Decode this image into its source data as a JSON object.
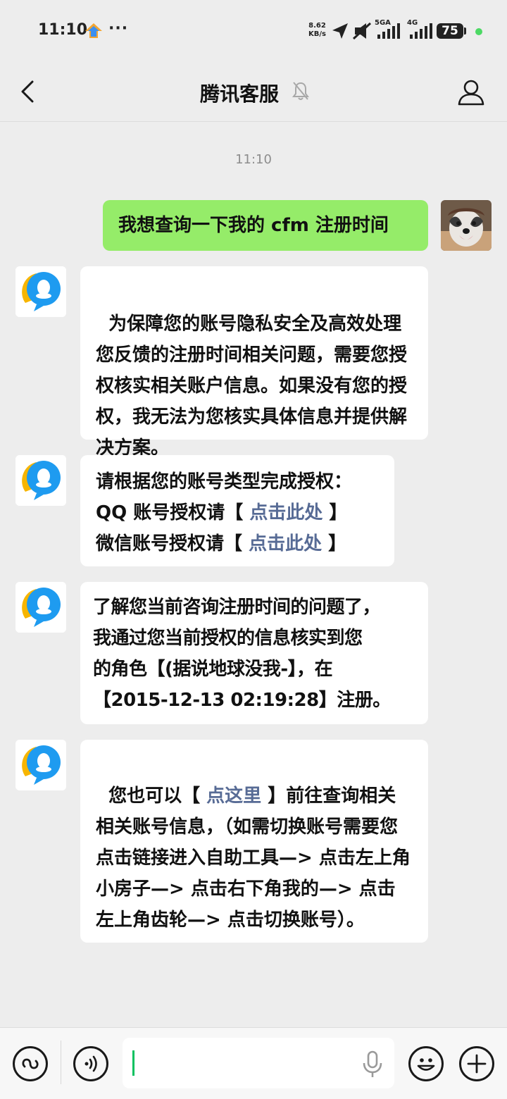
{
  "status_bar": {
    "time": "11:10",
    "dots": "···",
    "net_speed_value": "8.62",
    "net_speed_unit": "KB/s",
    "signal_label_1": "5GA",
    "signal_label_2": "4G",
    "battery": "75",
    "battery_level": 0.75,
    "icons": [
      "app-notification-icon",
      "location-arrow-icon",
      "mute-icon",
      "signal-5ga-icon",
      "signal-4g-icon",
      "battery-icon"
    ]
  },
  "header": {
    "title": "腾讯客服",
    "icons": [
      "back-chevron-icon",
      "bell-muted-icon",
      "profile-icon"
    ]
  },
  "chat": {
    "timestamp": "11:10",
    "messages": [
      {
        "sender": "me",
        "text": "我想查询一下我的 cfm 注册时间"
      },
      {
        "sender": "bot",
        "text": "为保障您的账号隐私安全及高效处理您反馈的注册时间相关问题，需要您授权核实相关账户信息。如果没有您的授权，我无法为您核实具体信息并提供解决方案。"
      },
      {
        "sender": "bot",
        "line1": "请根据您的账号类型完成授权：",
        "line2_prefix": "QQ 账号授权请【 ",
        "line2_link": "点击此处",
        "line2_suffix": " 】",
        "line3_prefix": "微信账号授权请【 ",
        "line3_link": "点击此处",
        "line3_suffix": " 】"
      },
      {
        "sender": "bot",
        "line1": "了解您当前咨询注册时间的问题了，",
        "line2": "我通过您当前授权的信息核实到您",
        "line3": "的角色【(据说地球没我-】，在",
        "line4": "【2015-12-13 02:19:28】注册。"
      },
      {
        "sender": "bot",
        "prefix": "您也可以【 ",
        "link": "点这里",
        "suffix": " 】前往查询相关相关账号信息，（如需切换账号需要您点击链接进入自助工具—> 点击左上角小房子—> 点击右下角我的—> 点击左上角齿轮—> 点击切换账号）。"
      }
    ]
  },
  "input_bar": {
    "value": "",
    "icons": [
      "mini-program-icon",
      "voice-icon",
      "mic-icon",
      "emoji-icon",
      "plus-icon"
    ]
  },
  "colors": {
    "background": "#ededed",
    "my_bubble": "#95ec69",
    "link": "#576b95",
    "qq_blue": "#1e9bf0",
    "qq_yellow": "#f7b500"
  }
}
